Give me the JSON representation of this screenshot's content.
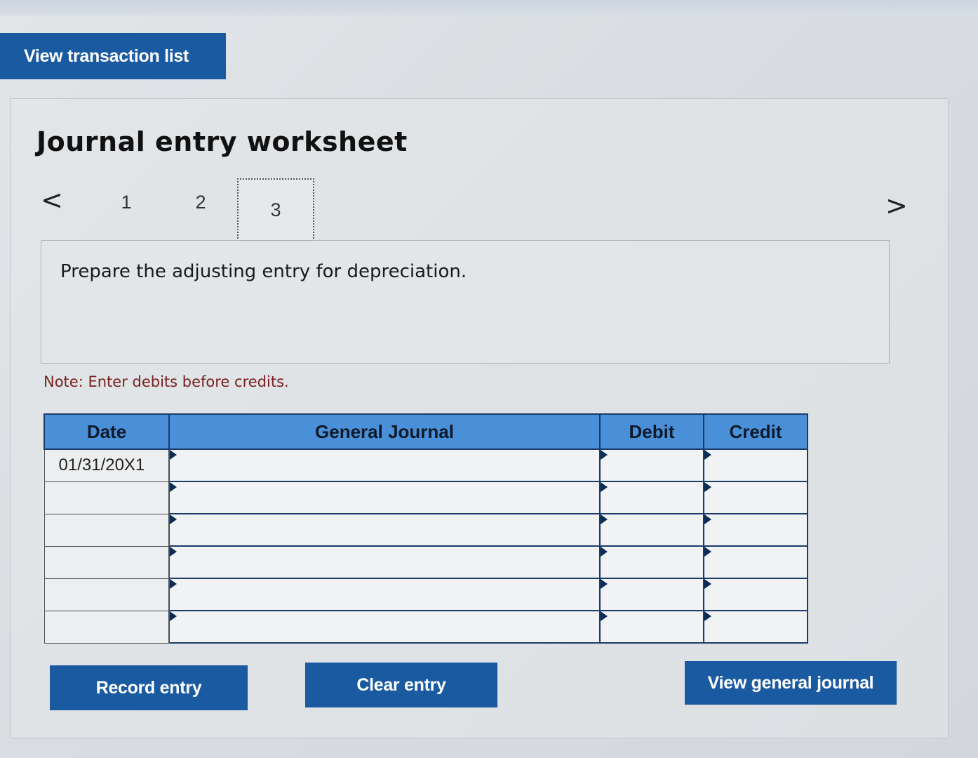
{
  "toolbar": {
    "view_transaction_list_label": "View transaction list"
  },
  "worksheet": {
    "title": "Journal entry worksheet",
    "steps": [
      "1",
      "2",
      "3"
    ],
    "active_step": 3,
    "prev_arrow": "<",
    "next_arrow": ">",
    "instruction": "Prepare the adjusting entry for depreciation.",
    "note": "Note: Enter debits before credits."
  },
  "journal": {
    "headers": {
      "date": "Date",
      "general_journal": "General Journal",
      "debit": "Debit",
      "credit": "Credit"
    },
    "rows": [
      {
        "date": "01/31/20X1",
        "account": "",
        "debit": "",
        "credit": ""
      },
      {
        "date": "",
        "account": "",
        "debit": "",
        "credit": ""
      },
      {
        "date": "",
        "account": "",
        "debit": "",
        "credit": ""
      },
      {
        "date": "",
        "account": "",
        "debit": "",
        "credit": ""
      },
      {
        "date": "",
        "account": "",
        "debit": "",
        "credit": ""
      },
      {
        "date": "",
        "account": "",
        "debit": "",
        "credit": ""
      }
    ]
  },
  "actions": {
    "record_entry_label": "Record entry",
    "clear_entry_label": "Clear entry",
    "view_general_journal_label": "View general journal"
  },
  "colors": {
    "button_blue": "#1a5aa0",
    "header_blue": "#4a90d9",
    "note_red": "#7a2020"
  }
}
